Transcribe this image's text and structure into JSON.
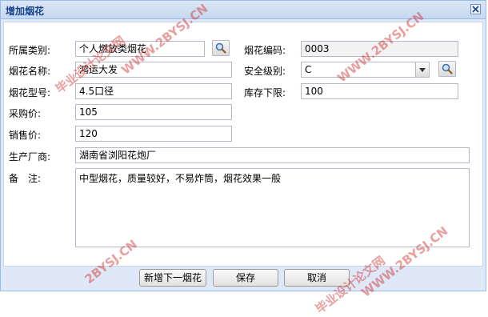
{
  "window": {
    "title": "增加烟花"
  },
  "form": {
    "category": {
      "label": "所属类别:",
      "value": "个人燃放类烟花"
    },
    "code": {
      "label": "烟花编码:",
      "value": "0003"
    },
    "name": {
      "label": "烟花名称:",
      "value": "鸿运大发"
    },
    "security_level": {
      "label": "安全级别:",
      "value": "C"
    },
    "model": {
      "label": "烟花型号:",
      "value": "4.5口径"
    },
    "stock_min": {
      "label": "库存下限:",
      "value": "100"
    },
    "purchase_price": {
      "label": "采购价:",
      "value": "105"
    },
    "sale_price": {
      "label": "销售价:",
      "value": "120"
    },
    "manufacturer": {
      "label": "生产厂商:",
      "value": "湖南省浏阳花炮厂"
    },
    "remark": {
      "label": "备　注:",
      "value": "中型烟花，质量较好，不易炸筒，烟花效果一般"
    }
  },
  "buttons": {
    "add_next": "新增下一烟花",
    "save": "保存",
    "cancel": "取消"
  },
  "watermarks": [
    "毕业设计论文网",
    "WWW.2BYSJ.CN",
    "WWW.2BYSJ.CN",
    "2BYSJ.CN",
    "WWW.2BYSJ.CN",
    "毕业设计论文网"
  ],
  "icons": {
    "lookup": "magnifier-icon",
    "close": "close-icon",
    "dropdown": "chevron-down-icon"
  },
  "colors": {
    "title": "#15428b",
    "frame": "#dfe8f6",
    "border": "#99bbe8",
    "watermark": "#d22828"
  }
}
